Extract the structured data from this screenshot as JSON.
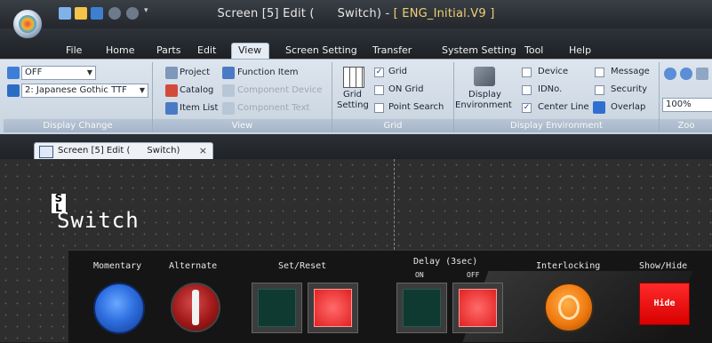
{
  "title_bar": {
    "title": "Screen [5] Edit (      Switch) - ",
    "project": "[ ENG_Initial.V9 ]",
    "quick_access_icons": [
      "new-icon",
      "open-icon",
      "save-icon",
      "undo-icon",
      "redo-icon",
      "customize-arrow-icon"
    ]
  },
  "menu": {
    "tabs": [
      "File",
      "Home",
      "Parts",
      "Edit",
      "View",
      "Screen Setting",
      "Transfer",
      "System Setting",
      "Tool",
      "Help"
    ],
    "active": "View"
  },
  "ribbon": {
    "display_change": {
      "label": "Display Change",
      "state_combo": "OFF",
      "font_combo": "2: Japanese Gothic TTF"
    },
    "view": {
      "label": "View",
      "project": "Project",
      "catalog": "Catalog",
      "item_list": "Item List",
      "function_item": "Function Item",
      "component_device": "Component Device",
      "component_text": "Component Text"
    },
    "grid": {
      "label": "Grid",
      "grid_setting_1": "Grid",
      "grid_setting_2": "Setting",
      "grid": "Grid",
      "grid_checked": true,
      "on_grid": "ON Grid",
      "on_grid_checked": false,
      "point_search": "Point Search",
      "point_search_checked": false
    },
    "display_env": {
      "label": "Display Environment",
      "env_1": "Display",
      "env_2": "Environment",
      "device": "Device",
      "idno": "IDNo.",
      "center_line": "Center Line",
      "message": "Message",
      "security": "Security",
      "overlap": "Overlap",
      "center_line_checked": true
    },
    "zoom": {
      "label": "Zoo",
      "value": "100%"
    }
  },
  "doc_tab": {
    "label": "Screen [5] Edit (      Switch)",
    "close": "×"
  },
  "screen": {
    "logo_line1": "S",
    "logo_line2": "L",
    "title": "Switch",
    "labels": {
      "momentary": "Momentary",
      "alternate": "Alternate",
      "set_reset": "Set/Reset",
      "delay": "Delay (3sec)",
      "on": "ON",
      "off": "OFF",
      "interlocking": "Interlocking",
      "show_hide": "Show/Hide"
    },
    "hide_button": "Hide"
  },
  "colors": {
    "accent_blue": "#2f6fe0",
    "red": "#e22020",
    "orange": "#f07a10",
    "canvas": "#2e2e2e"
  }
}
